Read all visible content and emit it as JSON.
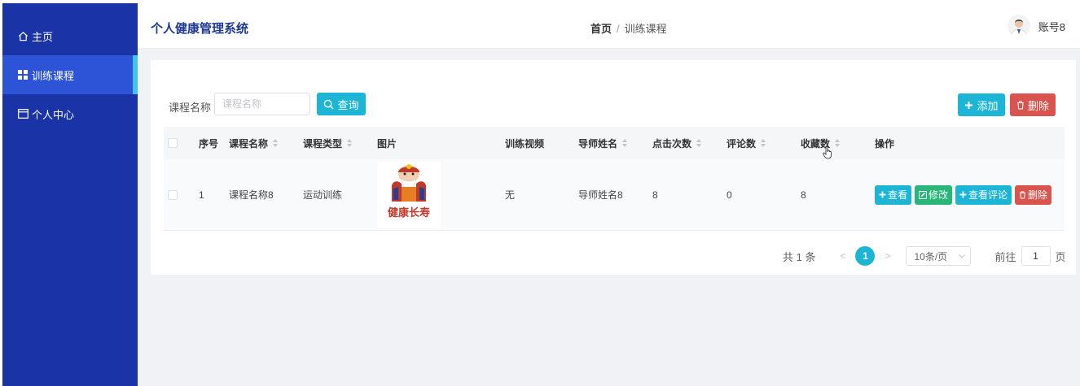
{
  "sidebar": {
    "items": [
      {
        "label": "主页",
        "icon": "home-icon"
      },
      {
        "label": "训练课程",
        "icon": "grid-icon"
      },
      {
        "label": "个人中心",
        "icon": "window-icon"
      }
    ],
    "active_index": 1
  },
  "header": {
    "title": "个人健康管理系统",
    "breadcrumb": {
      "home": "首页",
      "separator": "/",
      "current": "训练课程"
    },
    "user_name": "账号8"
  },
  "search": {
    "label": "课程名称",
    "placeholder": "课程名称",
    "value": "",
    "query_button": "查询"
  },
  "toolbar": {
    "add_label": "添加",
    "delete_label": "删除"
  },
  "table": {
    "headers": [
      "序号",
      "课程名称",
      "课程类型",
      "图片",
      "训练视频",
      "导师姓名",
      "点击次数",
      "评论数",
      "收藏数",
      "操作"
    ],
    "rows": [
      {
        "index": "1",
        "course_name": "课程名称8",
        "course_type": "运动训练",
        "image_text": "健康长寿",
        "video": "无",
        "teacher": "导师姓名8",
        "clicks": "8",
        "comments": "0",
        "favorites": "8"
      }
    ],
    "row_actions": {
      "view": "查看",
      "edit": "修改",
      "view_comments": "查看评论",
      "delete": "删除"
    }
  },
  "pagination": {
    "total_text": "共 1 条",
    "current_page": "1",
    "page_size": "10条/页",
    "goto_prefix": "前往",
    "goto_value": "1",
    "goto_suffix": "页"
  },
  "colors": {
    "sidebar": "#1a34a8",
    "sidebar_active": "#2d54d6",
    "accent": "#1cb5d6",
    "danger": "#d9534f",
    "success": "#28b779"
  }
}
